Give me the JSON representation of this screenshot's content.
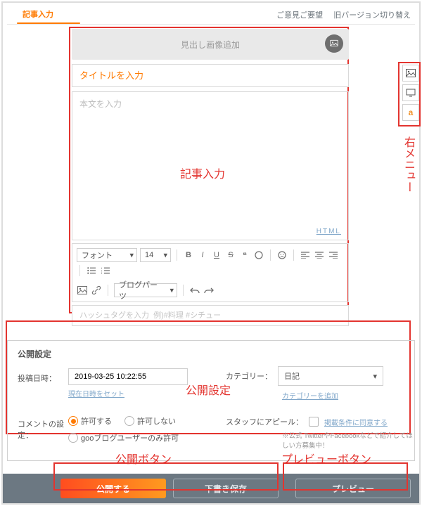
{
  "tabs": {
    "active": "記事入力",
    "links": {
      "feedback": "ご意見ご要望",
      "switch_old": "旧バージョン切り替え"
    }
  },
  "hero": {
    "label": "見出し画像追加"
  },
  "title": {
    "placeholder": "タイトルを入力"
  },
  "body": {
    "placeholder": "本文を入力",
    "html_link": "HTML"
  },
  "toolbar": {
    "font_label": "フォント",
    "size_value": "14",
    "blogparts_label": "ブログパーツ"
  },
  "hashtag": {
    "placeholder": "ハッシュタグを入力  例)#料理 #シチュー"
  },
  "side_menu": {
    "item3": "a"
  },
  "publish": {
    "heading": "公開設定",
    "datetime_label": "投稿日時：",
    "datetime_value": "2019-03-25 10:22:55",
    "set_now": "現在日時をセット",
    "category_label": "カテゴリー：",
    "category_value": "日記",
    "category_add": "カテゴリーを追加",
    "comment_label": "コメントの設定：",
    "comment_options": {
      "allow": "許可する",
      "deny": "許可しない",
      "goo_only": "gooブログユーザーのみ許可"
    },
    "appeal_label": "スタッフにアピール：",
    "appeal_link": "掲載条件に同意する",
    "appeal_note": "※公式 TwitterやFacebookなどで紹介してほしい方募集中！"
  },
  "annotations": {
    "editor": "記事入力",
    "side_menu": "右メニュー",
    "publish_box": "公開設定",
    "publish_btn": "公開ボタン",
    "preview_btn": "プレビューボタン"
  },
  "buttons": {
    "publish": "公開する",
    "save_draft": "下書き保存",
    "preview": "プレビュー"
  }
}
